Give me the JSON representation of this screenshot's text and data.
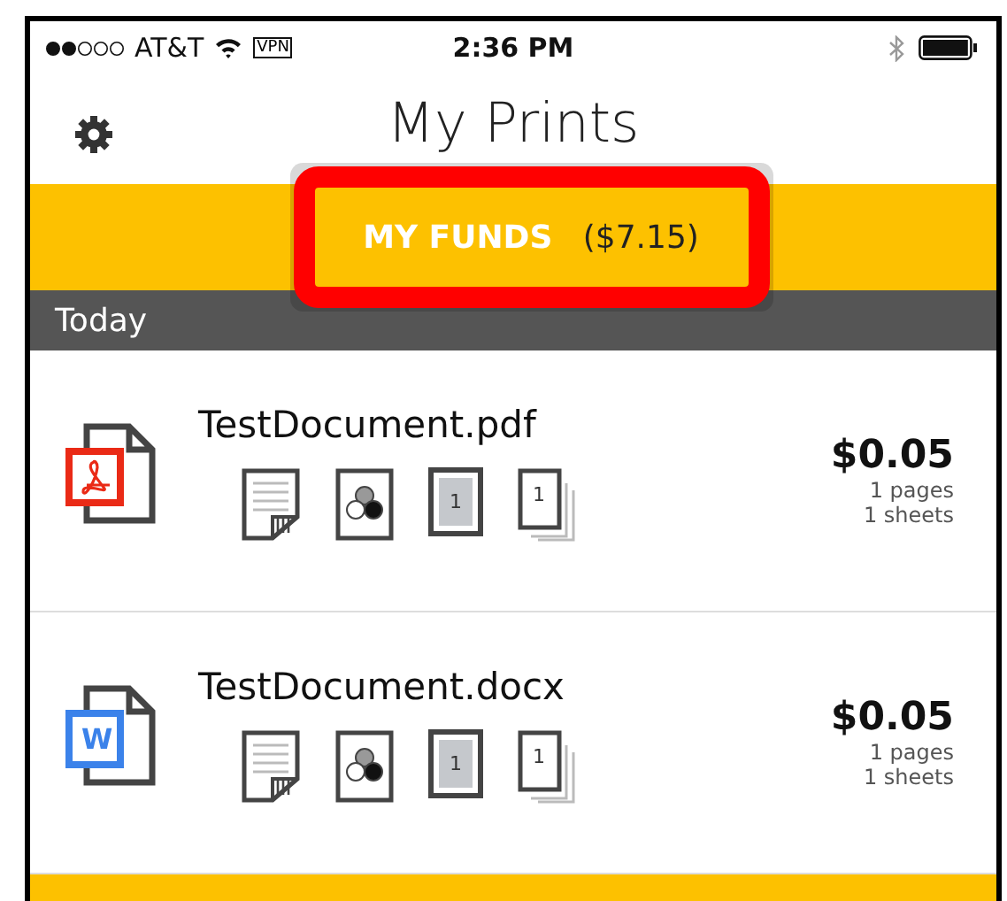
{
  "status_bar": {
    "carrier": "AT&T",
    "vpn": "VPN",
    "time": "2:36 PM"
  },
  "header": {
    "title": "My Prints"
  },
  "funds": {
    "label": "MY FUNDS",
    "amount": "($7.15)",
    "highlighted": true
  },
  "section": {
    "title": "Today"
  },
  "prints": [
    {
      "kind": "pdf",
      "name": "TestDocument.pdf",
      "option_labels": [
        "1",
        "1"
      ],
      "price": "$0.05",
      "pages": "1 pages",
      "sheets": "1 sheets"
    },
    {
      "kind": "word",
      "badge_letter": "W",
      "name": "TestDocument.docx",
      "option_labels": [
        "1",
        "1"
      ],
      "price": "$0.05",
      "pages": "1 pages",
      "sheets": "1 sheets"
    }
  ]
}
